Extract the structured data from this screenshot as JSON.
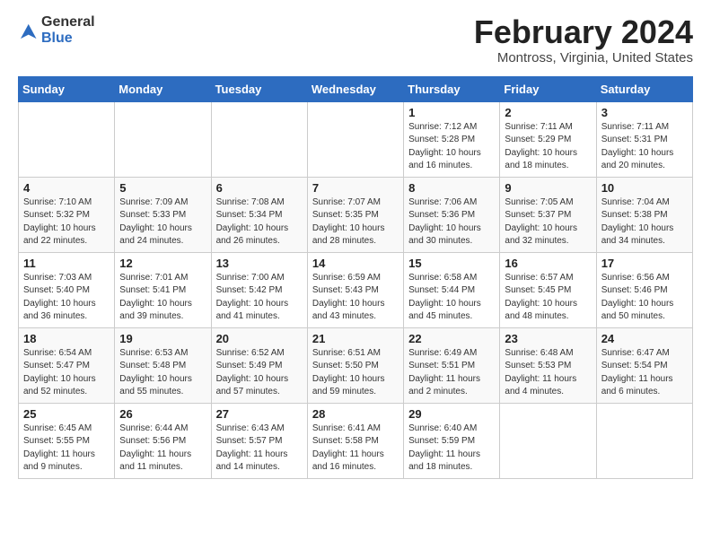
{
  "header": {
    "logo_line1": "General",
    "logo_line2": "Blue",
    "month": "February 2024",
    "location": "Montross, Virginia, United States"
  },
  "days_of_week": [
    "Sunday",
    "Monday",
    "Tuesday",
    "Wednesday",
    "Thursday",
    "Friday",
    "Saturday"
  ],
  "weeks": [
    [
      {
        "day": "",
        "info": ""
      },
      {
        "day": "",
        "info": ""
      },
      {
        "day": "",
        "info": ""
      },
      {
        "day": "",
        "info": ""
      },
      {
        "day": "1",
        "info": "Sunrise: 7:12 AM\nSunset: 5:28 PM\nDaylight: 10 hours\nand 16 minutes."
      },
      {
        "day": "2",
        "info": "Sunrise: 7:11 AM\nSunset: 5:29 PM\nDaylight: 10 hours\nand 18 minutes."
      },
      {
        "day": "3",
        "info": "Sunrise: 7:11 AM\nSunset: 5:31 PM\nDaylight: 10 hours\nand 20 minutes."
      }
    ],
    [
      {
        "day": "4",
        "info": "Sunrise: 7:10 AM\nSunset: 5:32 PM\nDaylight: 10 hours\nand 22 minutes."
      },
      {
        "day": "5",
        "info": "Sunrise: 7:09 AM\nSunset: 5:33 PM\nDaylight: 10 hours\nand 24 minutes."
      },
      {
        "day": "6",
        "info": "Sunrise: 7:08 AM\nSunset: 5:34 PM\nDaylight: 10 hours\nand 26 minutes."
      },
      {
        "day": "7",
        "info": "Sunrise: 7:07 AM\nSunset: 5:35 PM\nDaylight: 10 hours\nand 28 minutes."
      },
      {
        "day": "8",
        "info": "Sunrise: 7:06 AM\nSunset: 5:36 PM\nDaylight: 10 hours\nand 30 minutes."
      },
      {
        "day": "9",
        "info": "Sunrise: 7:05 AM\nSunset: 5:37 PM\nDaylight: 10 hours\nand 32 minutes."
      },
      {
        "day": "10",
        "info": "Sunrise: 7:04 AM\nSunset: 5:38 PM\nDaylight: 10 hours\nand 34 minutes."
      }
    ],
    [
      {
        "day": "11",
        "info": "Sunrise: 7:03 AM\nSunset: 5:40 PM\nDaylight: 10 hours\nand 36 minutes."
      },
      {
        "day": "12",
        "info": "Sunrise: 7:01 AM\nSunset: 5:41 PM\nDaylight: 10 hours\nand 39 minutes."
      },
      {
        "day": "13",
        "info": "Sunrise: 7:00 AM\nSunset: 5:42 PM\nDaylight: 10 hours\nand 41 minutes."
      },
      {
        "day": "14",
        "info": "Sunrise: 6:59 AM\nSunset: 5:43 PM\nDaylight: 10 hours\nand 43 minutes."
      },
      {
        "day": "15",
        "info": "Sunrise: 6:58 AM\nSunset: 5:44 PM\nDaylight: 10 hours\nand 45 minutes."
      },
      {
        "day": "16",
        "info": "Sunrise: 6:57 AM\nSunset: 5:45 PM\nDaylight: 10 hours\nand 48 minutes."
      },
      {
        "day": "17",
        "info": "Sunrise: 6:56 AM\nSunset: 5:46 PM\nDaylight: 10 hours\nand 50 minutes."
      }
    ],
    [
      {
        "day": "18",
        "info": "Sunrise: 6:54 AM\nSunset: 5:47 PM\nDaylight: 10 hours\nand 52 minutes."
      },
      {
        "day": "19",
        "info": "Sunrise: 6:53 AM\nSunset: 5:48 PM\nDaylight: 10 hours\nand 55 minutes."
      },
      {
        "day": "20",
        "info": "Sunrise: 6:52 AM\nSunset: 5:49 PM\nDaylight: 10 hours\nand 57 minutes."
      },
      {
        "day": "21",
        "info": "Sunrise: 6:51 AM\nSunset: 5:50 PM\nDaylight: 10 hours\nand 59 minutes."
      },
      {
        "day": "22",
        "info": "Sunrise: 6:49 AM\nSunset: 5:51 PM\nDaylight: 11 hours\nand 2 minutes."
      },
      {
        "day": "23",
        "info": "Sunrise: 6:48 AM\nSunset: 5:53 PM\nDaylight: 11 hours\nand 4 minutes."
      },
      {
        "day": "24",
        "info": "Sunrise: 6:47 AM\nSunset: 5:54 PM\nDaylight: 11 hours\nand 6 minutes."
      }
    ],
    [
      {
        "day": "25",
        "info": "Sunrise: 6:45 AM\nSunset: 5:55 PM\nDaylight: 11 hours\nand 9 minutes."
      },
      {
        "day": "26",
        "info": "Sunrise: 6:44 AM\nSunset: 5:56 PM\nDaylight: 11 hours\nand 11 minutes."
      },
      {
        "day": "27",
        "info": "Sunrise: 6:43 AM\nSunset: 5:57 PM\nDaylight: 11 hours\nand 14 minutes."
      },
      {
        "day": "28",
        "info": "Sunrise: 6:41 AM\nSunset: 5:58 PM\nDaylight: 11 hours\nand 16 minutes."
      },
      {
        "day": "29",
        "info": "Sunrise: 6:40 AM\nSunset: 5:59 PM\nDaylight: 11 hours\nand 18 minutes."
      },
      {
        "day": "",
        "info": ""
      },
      {
        "day": "",
        "info": ""
      }
    ]
  ]
}
